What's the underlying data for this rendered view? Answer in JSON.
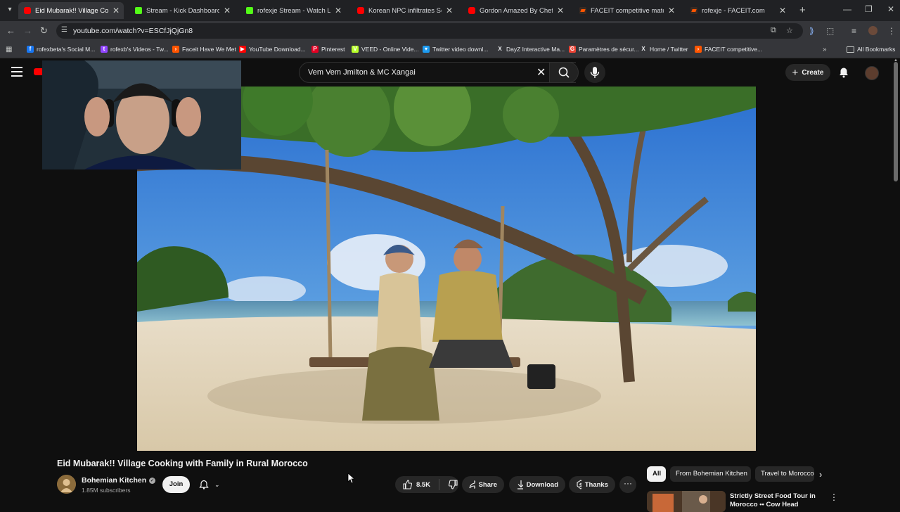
{
  "browser": {
    "tabs": [
      {
        "title": "Eid Mubarak!! Village Cooking ...",
        "icon": "youtube",
        "active": true
      },
      {
        "title": "Stream - Kick Dashboard",
        "icon": "kick",
        "active": false
      },
      {
        "title": "rofexje Stream - Watch Live on",
        "icon": "kick",
        "active": false
      },
      {
        "title": "Korean NPC infiltrates Sony HQ",
        "icon": "youtube",
        "active": false
      },
      {
        "title": "Gordon Amazed By Chef Who I",
        "icon": "youtube",
        "active": false
      },
      {
        "title": "FACEIT competitive match - FA",
        "icon": "faceit",
        "active": false
      },
      {
        "title": "rofexje - FACEIT.com",
        "icon": "faceit",
        "active": false
      }
    ],
    "url": "youtube.com/watch?v=ESCfJjQjGn8",
    "bookmarks": [
      {
        "label": "rofexbeta's Social M...",
        "icon": "facebook",
        "color": "#1877f2"
      },
      {
        "label": "rofexb's Videos - Tw...",
        "icon": "twitch",
        "color": "#9146ff"
      },
      {
        "label": "Faceit Have We Met",
        "icon": "faceit",
        "color": "#ff5500"
      },
      {
        "label": "YouTube Download...",
        "icon": "youtube",
        "color": "#ff0000"
      },
      {
        "label": "Pinterest",
        "icon": "pinterest",
        "color": "#e60023"
      },
      {
        "label": "VEED - Online Vide...",
        "icon": "veed",
        "color": "#b8ff2a"
      },
      {
        "label": "Twitter video downl...",
        "icon": "twitter",
        "color": "#1d9bf0"
      },
      {
        "label": "DayZ Interactive Ma...",
        "icon": "x",
        "color": "#e8eaed"
      },
      {
        "label": "Paramètres de sécur...",
        "icon": "google",
        "color": "#ea4335"
      },
      {
        "label": "Home / Twitter",
        "icon": "x",
        "color": "#e8eaed"
      },
      {
        "label": "FACEIT competitive...",
        "icon": "faceit",
        "color": "#ff5500"
      }
    ],
    "all_bookmarks": "All Bookmarks"
  },
  "youtube": {
    "search_query": "Vem Vem Jmilton & MC Xangai",
    "create_label": "Create",
    "video": {
      "title": "Eid Mubarak!! Village Cooking with Family in Rural Morocco",
      "channel": "Bohemian Kitchen",
      "subscribers": "1.85M subscribers",
      "join_label": "Join",
      "likes": "8.5K",
      "share_label": "Share",
      "download_label": "Download",
      "thanks_label": "Thanks"
    },
    "chips": [
      "All",
      "From Bohemian Kitchen",
      "Travel to Morocco"
    ],
    "recommendation": {
      "title": "Strictly Street Food Tour in Morocco •• Cow Head"
    }
  },
  "colors": {
    "yt_red": "#ff0000",
    "background": "#0f0f0f",
    "chip_active": "#f1f1f1"
  }
}
